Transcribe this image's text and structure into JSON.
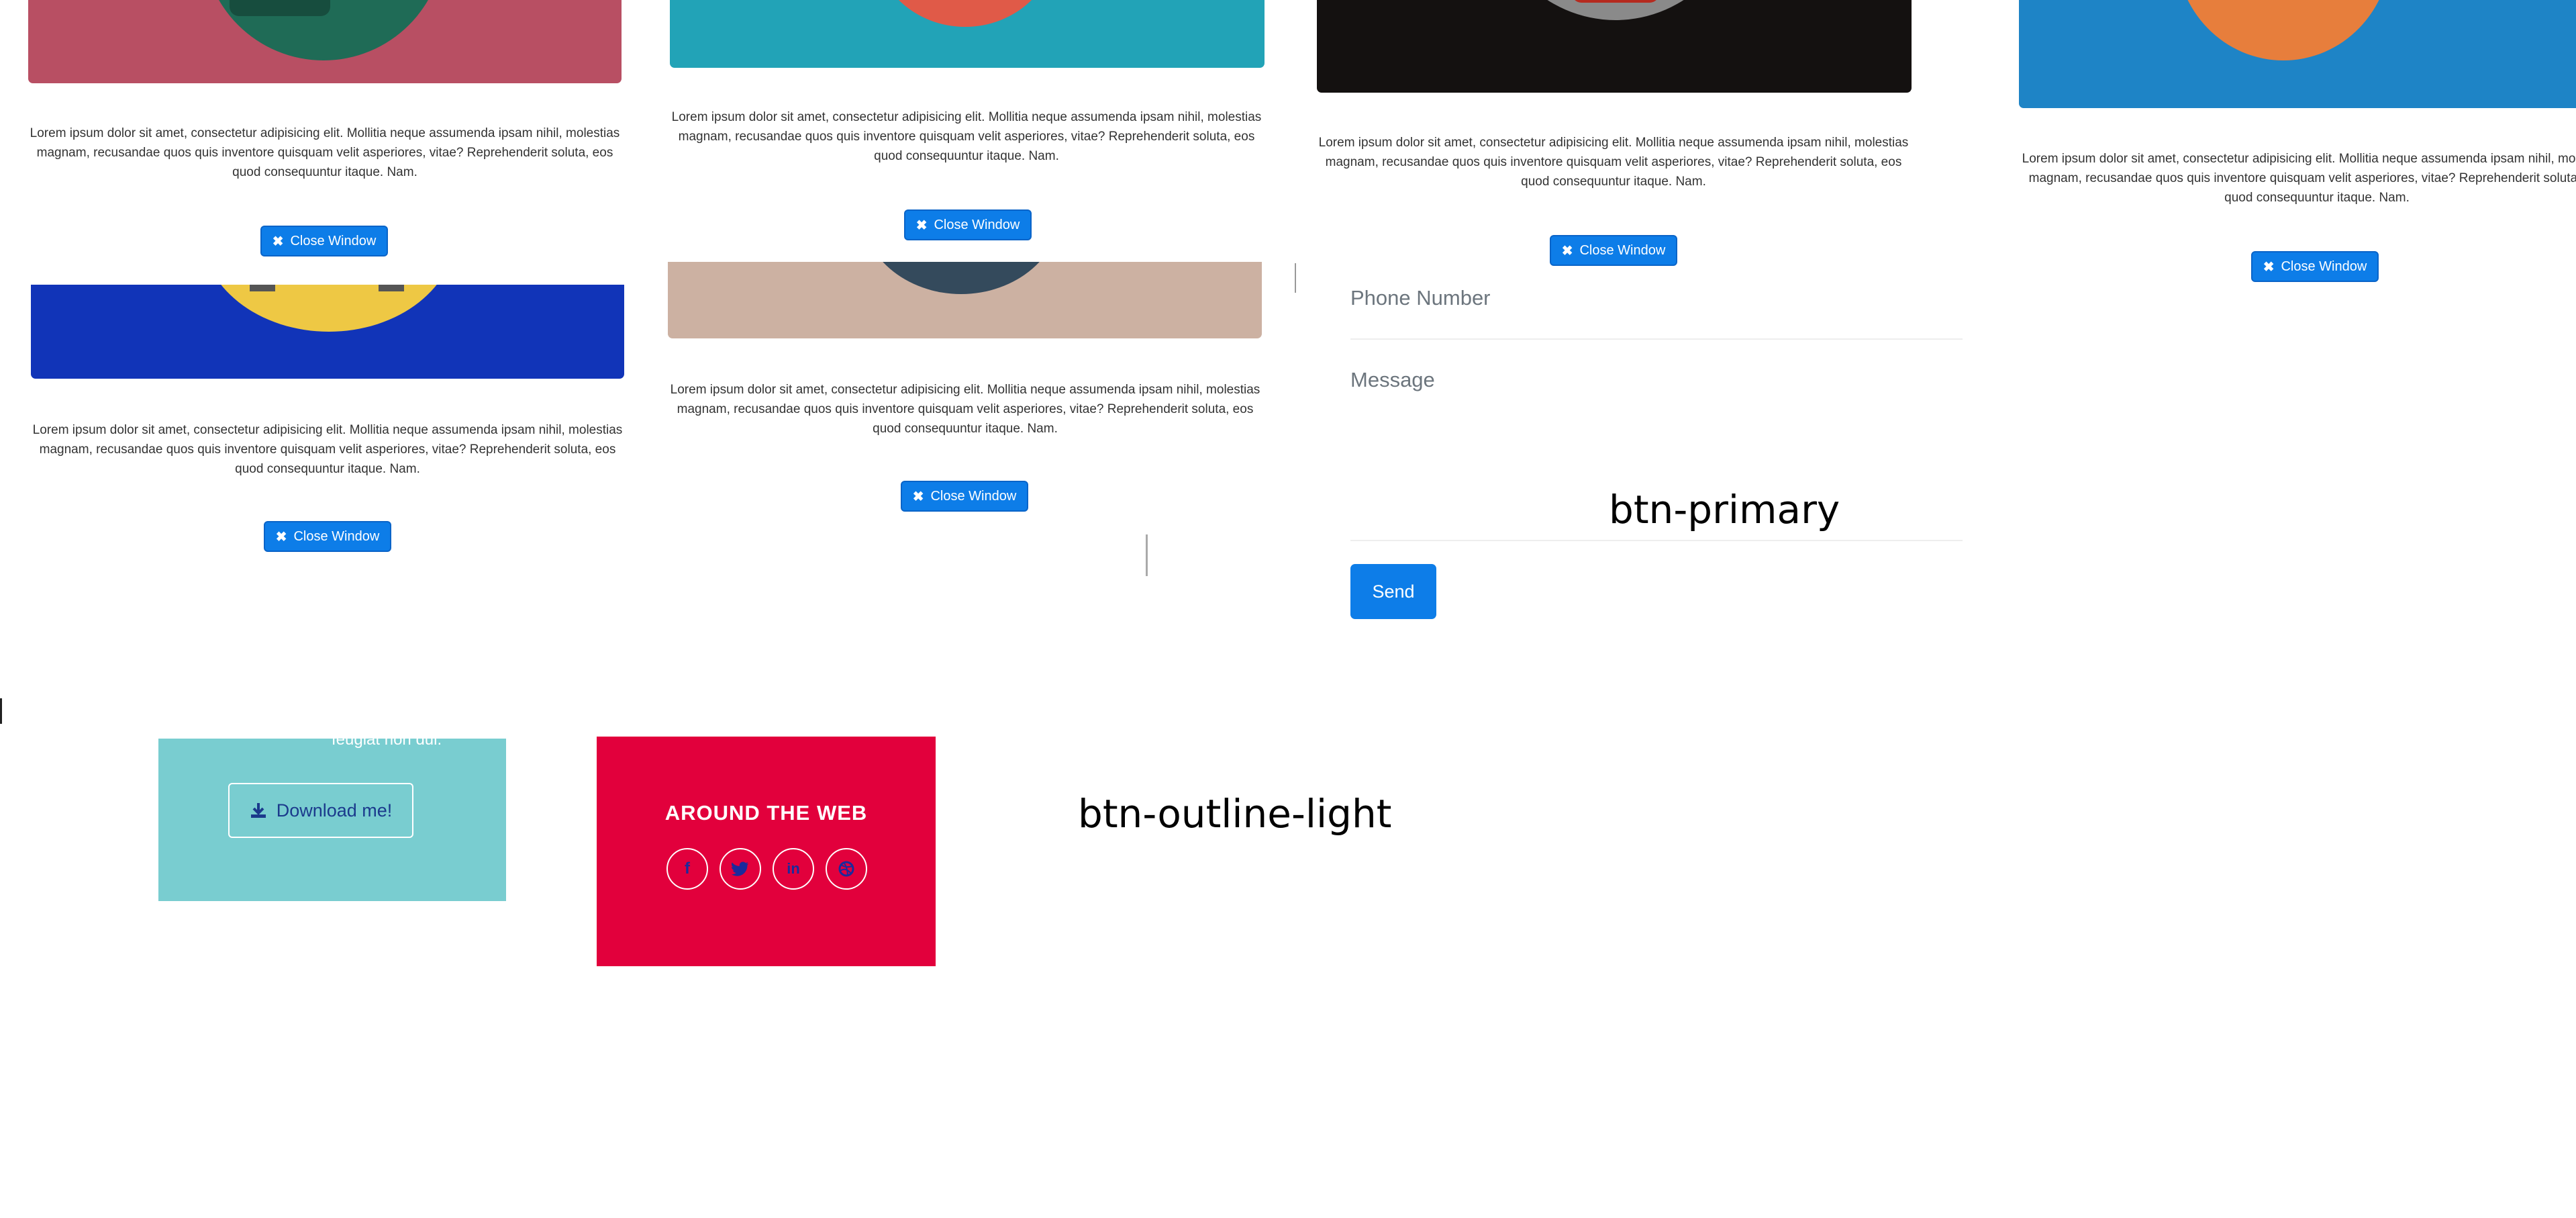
{
  "cards": [
    {
      "id": "c1",
      "text": "Lorem ipsum dolor sit amet, consectetur adipisicing elit. Mollitia neque assumenda ipsam nihil, molestias magnam, recusandae quos quis inventore quisquam velit asperiores, vitae? Reprehenderit soluta, eos quod consequuntur itaque. Nam.",
      "button": "Close Window",
      "bg": "#b84f63"
    },
    {
      "id": "c2",
      "text": "Lorem ipsum dolor sit amet, consectetur adipisicing elit. Mollitia neque assumenda ipsam nihil, molestias magnam, recusandae quos quis inventore quisquam velit asperiores, vitae? Reprehenderit soluta, eos quod consequuntur itaque. Nam.",
      "button": "Close Window",
      "bg": "#22a3b7"
    },
    {
      "id": "c3",
      "text": "Lorem ipsum dolor sit amet, consectetur adipisicing elit. Mollitia neque assumenda ipsam nihil, molestias magnam, recusandae quos quis inventore quisquam velit asperiores, vitae? Reprehenderit soluta, eos quod consequuntur itaque. Nam.",
      "button": "Close Window",
      "bg": "#141110"
    },
    {
      "id": "c4",
      "text": "Lorem ipsum dolor sit amet, consectetur adipisicing elit. Mollitia neque assumenda ipsam nihil, molestias magnam, recusandae quos quis inventore quisquam velit asperiores, vitae? Reprehenderit soluta, eos quod consequuntur itaque. Nam.",
      "button": "Close Window",
      "bg": "#1e84c6"
    },
    {
      "id": "c5",
      "text": "Lorem ipsum dolor sit amet, consectetur adipisicing elit. Mollitia neque assumenda ipsam nihil, molestias magnam, recusandae quos quis inventore quisquam velit asperiores, vitae? Reprehenderit soluta, eos quod consequuntur itaque. Nam.",
      "button": "Close Window",
      "bg": "#1134b8"
    },
    {
      "id": "c6",
      "text": "Lorem ipsum dolor sit amet, consectetur adipisicing elit. Mollitia neque assumenda ipsam nihil, molestias magnam, recusandae quos quis inventore quisquam velit asperiores, vitae? Reprehenderit soluta, eos quod consequuntur itaque. Nam.",
      "button": "Close Window",
      "bg": "#ccb1a2"
    }
  ],
  "contact": {
    "phone_placeholder": "Phone Number",
    "message_placeholder": "Message",
    "send_label": "Send"
  },
  "captions": {
    "primary": "btn-primary",
    "outline_light": "btn-outline-light"
  },
  "download": {
    "fragment": "feugiat non dui.",
    "button_label": "Download me!"
  },
  "around_web": {
    "title": "AROUND THE WEB",
    "icons": [
      "facebook-icon",
      "twitter-icon",
      "linkedin-icon",
      "dribbble-icon"
    ]
  },
  "colors": {
    "primary": "#0d7de8",
    "download_bg": "#79cdd0",
    "around_web_bg": "#e2003c"
  }
}
